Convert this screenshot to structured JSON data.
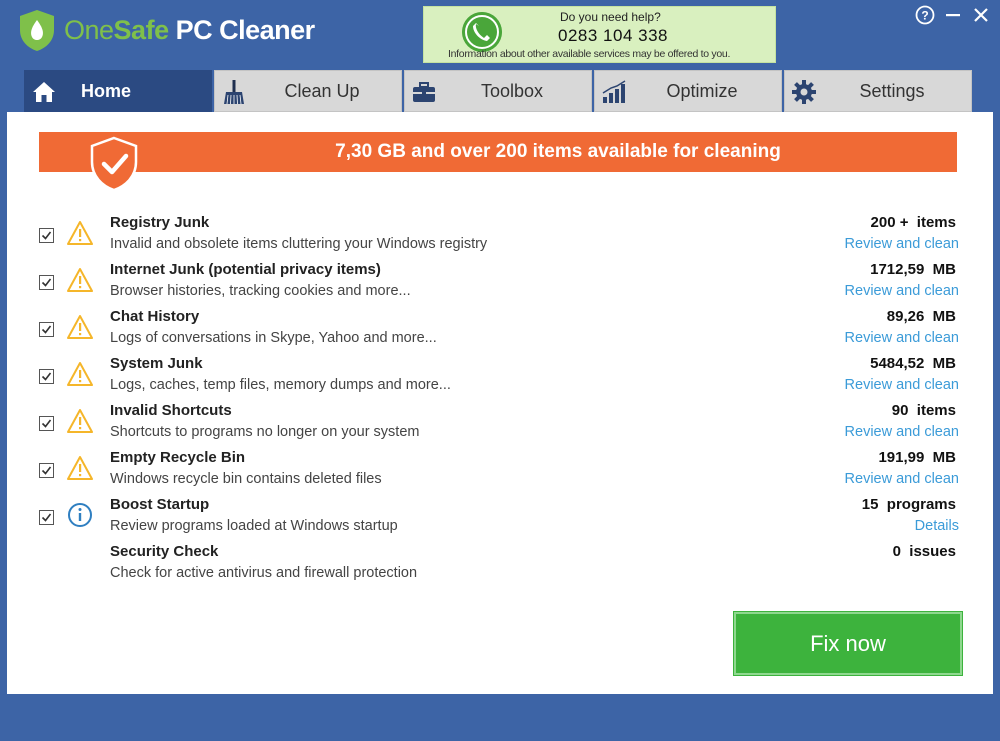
{
  "app": {
    "name_one": "One",
    "name_safe": "Safe",
    "name_pc": " PC Cleaner"
  },
  "help": {
    "title": "Do you need help?",
    "number": "0283 104 338",
    "note": "Information about other available services may be offered to you."
  },
  "window_controls": {
    "help": "?",
    "minimize": "—",
    "close": "✕"
  },
  "tabs": [
    {
      "label": "Home",
      "icon": "home-icon",
      "active": true
    },
    {
      "label": "Clean Up",
      "icon": "broom-icon",
      "active": false
    },
    {
      "label": "Toolbox",
      "icon": "toolbox-icon",
      "active": false
    },
    {
      "label": "Optimize",
      "icon": "bar-chart-icon",
      "active": false
    },
    {
      "label": "Settings",
      "icon": "gear-icon",
      "active": false
    }
  ],
  "banner": {
    "text": "7,30 GB and over 200 items available for cleaning"
  },
  "items": [
    {
      "title": "Registry Junk",
      "desc": "Invalid and obsolete items cluttering your Windows registry",
      "value": "200 +  items",
      "link": "Review and clean",
      "checked": true,
      "icon": "warning-icon"
    },
    {
      "title": "Internet Junk (potential privacy items)",
      "desc": "Browser histories, tracking cookies and more...",
      "value": "1712,59  MB",
      "link": "Review and clean",
      "checked": true,
      "icon": "warning-icon"
    },
    {
      "title": "Chat History",
      "desc": "Logs of conversations in Skype, Yahoo and more...",
      "value": "89,26  MB",
      "link": "Review and clean",
      "checked": true,
      "icon": "warning-icon"
    },
    {
      "title": "System Junk",
      "desc": "Logs, caches, temp files, memory dumps and more...",
      "value": "5484,52  MB",
      "link": "Review and clean",
      "checked": true,
      "icon": "warning-icon"
    },
    {
      "title": "Invalid Shortcuts",
      "desc": "Shortcuts to programs no longer on your system",
      "value": "90  items",
      "link": "Review and clean",
      "checked": true,
      "icon": "warning-icon"
    },
    {
      "title": "Empty Recycle Bin",
      "desc": "Windows recycle bin contains deleted files",
      "value": "191,99  MB",
      "link": "Review and clean",
      "checked": true,
      "icon": "warning-icon"
    },
    {
      "title": "Boost Startup",
      "desc": "Review programs loaded at Windows startup",
      "value": "15  programs",
      "link": "Details",
      "checked": true,
      "icon": "info-icon"
    },
    {
      "title": "Security Check",
      "desc": "Check for active antivirus and firewall protection",
      "value": "0  issues",
      "link": "",
      "checked": false,
      "icon": ""
    }
  ],
  "fix_button": {
    "label": "Fix now"
  },
  "colors": {
    "frame": "#3d64a6",
    "active_tab": "#2b4a82",
    "banner": "#f06a35",
    "link": "#3b9bd8",
    "fix_button": "#3db33d",
    "warning": "#f5b62a",
    "info": "#2f7fc1"
  }
}
